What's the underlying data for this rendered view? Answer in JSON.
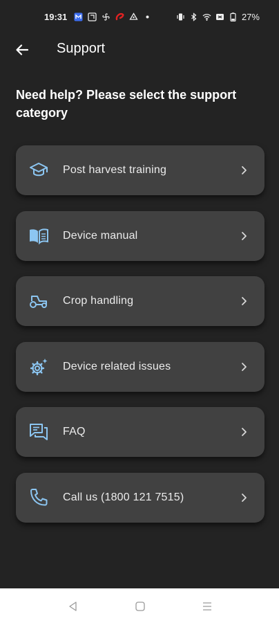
{
  "status_bar": {
    "time": "19:31",
    "battery": "27%",
    "left_icons": [
      "app-notification-icon",
      "message-icon",
      "fan-icon",
      "airtel-icon",
      "recycle-icon",
      "dot-icon"
    ],
    "right_icons": [
      "vibrate-icon",
      "bluetooth-icon",
      "wifi-icon",
      "sim-icon",
      "battery-icon"
    ]
  },
  "header": {
    "title": "Support",
    "back_icon": "arrow-left-icon"
  },
  "prompt": "Need help? Please select the support category",
  "menu": {
    "items": [
      {
        "label": "Post harvest training",
        "icon": "graduation-cap-icon"
      },
      {
        "label": "Device manual",
        "icon": "book-icon"
      },
      {
        "label": "Crop handling",
        "icon": "tractor-icon"
      },
      {
        "label": "Device related issues",
        "icon": "gear-sparkle-icon"
      },
      {
        "label": "FAQ",
        "icon": "chat-icon"
      },
      {
        "label": "Call us (1800 121 7515)",
        "icon": "phone-icon"
      }
    ]
  },
  "nav_bar": {
    "buttons": [
      "back-triangle-icon",
      "home-square-icon",
      "menu-lines-icon"
    ]
  },
  "colors": {
    "background": "#232323",
    "card": "#414141",
    "icon_accent": "#8cc6f2",
    "nav_background": "#ffffff"
  }
}
